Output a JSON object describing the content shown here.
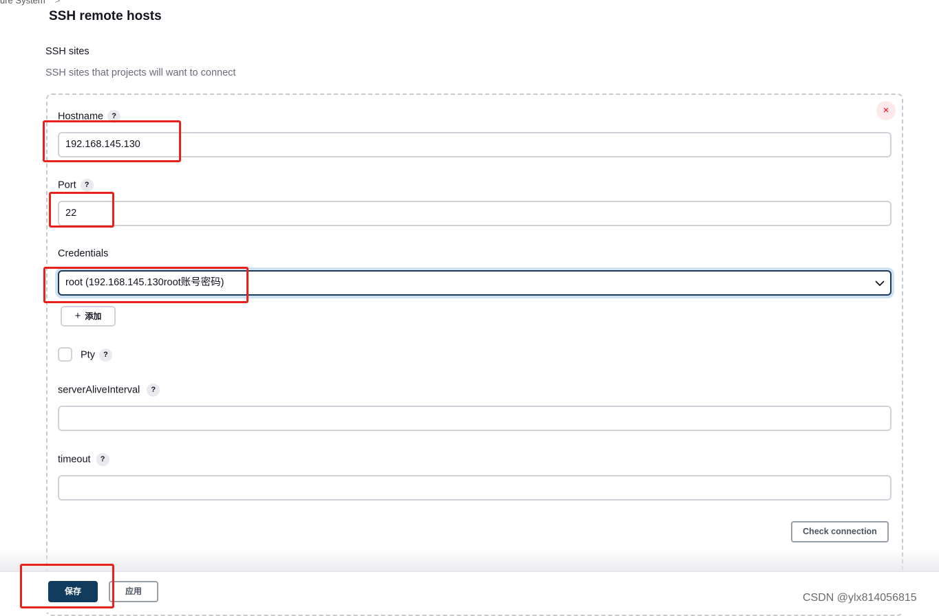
{
  "breadcrumb": {
    "text": "ure System",
    "separator": ">"
  },
  "section_title": "SSH remote hosts",
  "ssh_sites": {
    "label": "SSH sites",
    "description": "SSH sites that projects will want to connect"
  },
  "help_glyph": "?",
  "close_glyph": "×",
  "hostname": {
    "label": "Hostname",
    "value": "192.168.145.130"
  },
  "port": {
    "label": "Port",
    "value": "22"
  },
  "credentials": {
    "label": "Credentials",
    "selected": "root (192.168.145.130root账号密码)"
  },
  "add_button": {
    "icon": "+",
    "label": "添加"
  },
  "pty": {
    "label": "Pty",
    "checked": false
  },
  "server_alive_interval": {
    "label": "serverAliveInterval",
    "value": ""
  },
  "timeout": {
    "label": "timeout",
    "value": ""
  },
  "check_connection_label": "Check connection",
  "footer": {
    "save_label": "保存",
    "apply_label": "应用"
  },
  "watermark": "CSDN @ylx814056815",
  "colors": {
    "primary": "#123c5e",
    "annotation_red": "#e8211b",
    "close_red": "#e6001f",
    "focus_ring": "#cfe2f2"
  }
}
